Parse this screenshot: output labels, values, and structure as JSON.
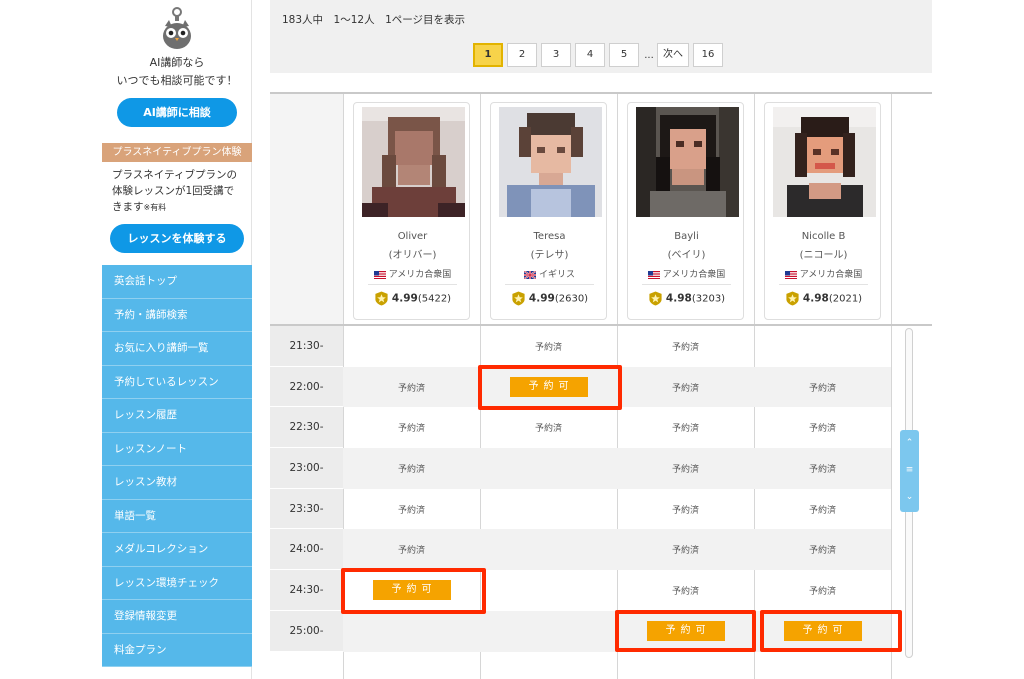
{
  "sidebar": {
    "ai_line1": "AI講師なら",
    "ai_line2": "いつでも相談可能です！",
    "ai_button": "AI講師に相談",
    "trial_header": "プラスネイティブプラン体験",
    "trial_line1": "プラスネイティブプランの",
    "trial_line2": "体験レッスンが1回受講で",
    "trial_line3": "きます",
    "trial_paid": "※有料",
    "trial_button": "レッスンを体験する",
    "menu": [
      {
        "label": "英会話トップ"
      },
      {
        "label": "予約・講師検索"
      },
      {
        "label": "お気に入り講師一覧"
      },
      {
        "label": "予約しているレッスン"
      },
      {
        "label": "レッスン履歴"
      },
      {
        "label": "レッスンノート"
      },
      {
        "label": "レッスン教材"
      },
      {
        "label": "単語一覧"
      },
      {
        "label": "メダルコレクション"
      },
      {
        "label": "レッスン環境チェック"
      },
      {
        "label": "登録情報変更"
      },
      {
        "label": "料金プラン"
      }
    ]
  },
  "results": {
    "summary": "183人中　1〜12人　1ページ目を表示"
  },
  "pagination": {
    "pages": [
      "1",
      "2",
      "3",
      "4",
      "5"
    ],
    "active": "1",
    "ellipsis": "...",
    "next": "次へ",
    "last": "16"
  },
  "teachers": [
    {
      "name": "Oliver",
      "kana": "(オリバー)",
      "country": "アメリカ合衆国",
      "flag": "us",
      "rating": "4.99",
      "reviews": "(5422)"
    },
    {
      "name": "Teresa",
      "kana": "(テレサ)",
      "country": "イギリス",
      "flag": "uk",
      "rating": "4.99",
      "reviews": "(2630)"
    },
    {
      "name": "Bayli",
      "kana": "(ベイリ)",
      "country": "アメリカ合衆国",
      "flag": "us",
      "rating": "4.98",
      "reviews": "(3203)"
    },
    {
      "name": "Nicolle B",
      "kana": "(ニコール)",
      "country": "アメリカ合衆国",
      "flag": "us",
      "rating": "4.98",
      "reviews": "(2021)"
    }
  ],
  "schedule": {
    "times": [
      "21:30-",
      "22:00-",
      "22:30-",
      "23:00-",
      "23:30-",
      "24:00-",
      "24:30-",
      "25:00-"
    ],
    "booked_label": "予約済",
    "available_label": "予約可",
    "rows": [
      [
        "",
        "予約済",
        "予約済",
        ""
      ],
      [
        "予約済",
        "予約可",
        "予約済",
        "予約済"
      ],
      [
        "予約済",
        "予約済",
        "予約済",
        "予約済"
      ],
      [
        "予約済",
        "",
        "予約済",
        "予約済"
      ],
      [
        "予約済",
        "",
        "予約済",
        "予約済"
      ],
      [
        "予約済",
        "",
        "予約済",
        "予約済"
      ],
      [
        "予約可",
        "",
        "予約済",
        "予約済"
      ],
      [
        "",
        "",
        "予約可",
        "予約可"
      ]
    ]
  },
  "colors": {
    "sidebar_menu": "#55b8ea",
    "primary_button": "#0f98e6",
    "book_button": "#f5a300",
    "highlight": "#ff2a00",
    "trial_header": "#d9a37a",
    "active_page": "#f7d34a"
  }
}
